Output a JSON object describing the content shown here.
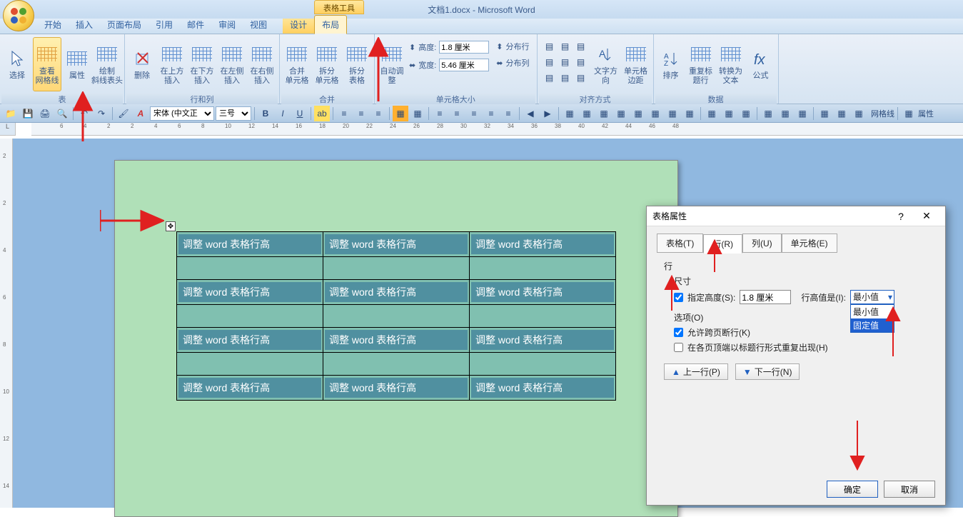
{
  "title": {
    "context_tab": "表格工具",
    "document": "文档1.docx - Microsoft Word"
  },
  "tabs": {
    "home": "开始",
    "insert": "插入",
    "page_layout": "页面布局",
    "references": "引用",
    "mailings": "邮件",
    "review": "审阅",
    "view": "视图",
    "design": "设计",
    "layout": "布局"
  },
  "ribbon": {
    "select": "选择",
    "view_gridlines": "查看\n网格线",
    "properties": "属性",
    "draw": "绘制\n斜线表头",
    "delete": "删除",
    "insert_above": "在上方\n插入",
    "insert_below": "在下方\n插入",
    "insert_left": "在左侧\n插入",
    "insert_right": "在右侧\n插入",
    "rows_cols_group": "行和列",
    "merge_cells": "合并\n单元格",
    "split_cells": "拆分\n单元格",
    "split_table": "拆分\n表格",
    "merge_group": "合并",
    "autofit": "自动调整",
    "height_lbl": "高度:",
    "height_val": "1.8 厘米",
    "dist_rows": "分布行",
    "width_lbl": "宽度:",
    "width_val": "5.46 厘米",
    "dist_cols": "分布列",
    "cell_size_group": "单元格大小",
    "text_dir": "文字方向",
    "cell_margins": "单元格\n边距",
    "align_group": "对齐方式",
    "sort": "排序",
    "repeat_header": "重复标题行",
    "to_text": "转换为文本",
    "formula": "公式",
    "data_group": "数据"
  },
  "toolbar": {
    "font": "宋体 (中文正",
    "size": "三号"
  },
  "table": {
    "cell_text": "调整 word 表格行高"
  },
  "dialog": {
    "title": "表格属性",
    "tab_table": "表格(T)",
    "tab_row": "行(R)",
    "tab_col": "列(U)",
    "tab_cell": "单元格(E)",
    "row_label": "行",
    "size_label": "尺寸",
    "specify_height": "指定高度(S):",
    "height_value": "1.8 厘米",
    "row_height_is": "行高值是(I):",
    "combo_selected": "最小值",
    "combo_opts": {
      "min": "最小值",
      "fixed": "固定值"
    },
    "options_label": "选项(O)",
    "allow_break": "允许跨页断行(K)",
    "repeat_header": "在各页顶端以标题行形式重复出现(H)",
    "prev_row": "上一行(P)",
    "next_row": "下一行(N)",
    "ok": "确定",
    "cancel": "取消"
  },
  "toolbar_extra": {
    "gridlines": "网格线",
    "properties": "属性"
  },
  "ruler_numbers": [
    6,
    4,
    2,
    2,
    4,
    6,
    8,
    10,
    12,
    14,
    16,
    18,
    20,
    22,
    24,
    26,
    28,
    30,
    32,
    34,
    36,
    38,
    40,
    42,
    44,
    46,
    48
  ],
  "vruler": [
    2,
    2,
    4,
    6,
    8,
    10,
    12,
    14
  ]
}
